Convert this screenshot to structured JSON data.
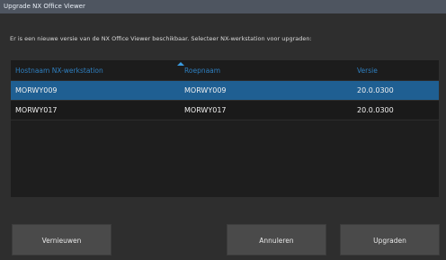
{
  "window": {
    "title": "Upgrade NX Office Viewer"
  },
  "message": "Er is een nieuwe versie van de NX Office Viewer beschikbaar. Selecteer NX-werkstation voor upgraden:",
  "table": {
    "columns": [
      "Hostnaam NX-werkstation",
      "Roepnaam",
      "Versie"
    ],
    "sorted_column": "Roepnaam",
    "rows": [
      {
        "host": "MORWY009",
        "name": "MORWY009",
        "version": "20.0.0300",
        "selected": true
      },
      {
        "host": "MORWY017",
        "name": "MORWY017",
        "version": "20.0.0300",
        "selected": false
      }
    ]
  },
  "buttons": {
    "refresh": "Vernieuwen",
    "cancel": "Annuleren",
    "upgrade": "Upgraden"
  },
  "colors": {
    "selection": "#1f5f92",
    "header_text": "#2e7fc0",
    "background": "#2e2e2e"
  }
}
